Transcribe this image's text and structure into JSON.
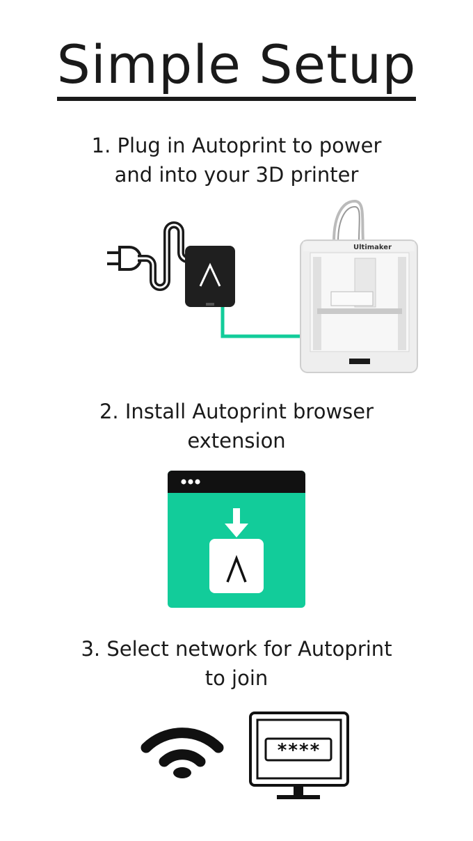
{
  "title": "Simple Setup",
  "steps": [
    {
      "line1": "1.  Plug in Autoprint to power",
      "line2": "and into your 3D printer"
    },
    {
      "line1": "2. Install Autoprint browser",
      "line2": "extension"
    },
    {
      "line1": "3. Select network for Autoprint",
      "line2": "to join"
    }
  ],
  "printer": {
    "brand": "Ultimaker"
  },
  "password_mask": "****",
  "colors": {
    "accent": "#12cc9a",
    "dark": "#1a1a1a"
  },
  "icons": [
    "power-plug-icon",
    "autoprint-device-icon",
    "printer-image",
    "browser-extension-icon",
    "download-arrow-icon",
    "wifi-icon",
    "monitor-password-icon"
  ]
}
